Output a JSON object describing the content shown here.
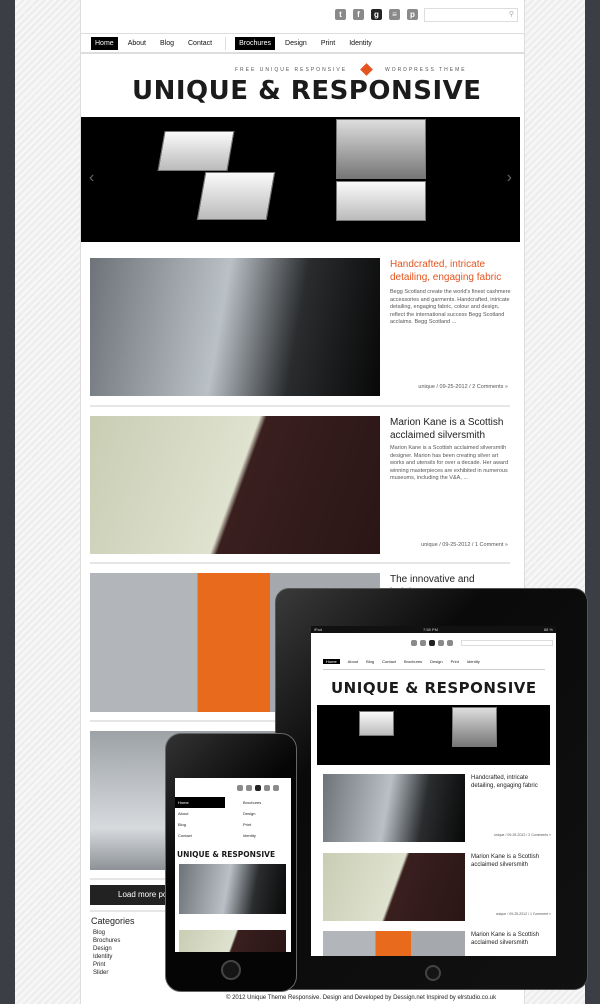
{
  "social_icons": [
    "twitter-icon",
    "facebook-icon",
    "google-plus-icon",
    "rss-icon",
    "pinterest-icon"
  ],
  "search": {
    "placeholder": "",
    "icon": "search-icon"
  },
  "nav": {
    "left": [
      "Home",
      "About",
      "Blog",
      "Contact"
    ],
    "right": [
      "Brochures",
      "Design",
      "Print",
      "Identity"
    ],
    "active": [
      "Home",
      "Brochures"
    ]
  },
  "header": {
    "tagline_left": "FREE UNIQUE RESPONSIVE",
    "tagline_right": "WORDPRESS THEME",
    "title": "UNIQUE & RESPONSIVE",
    "accent": "#e5541e"
  },
  "slider": {
    "prev": "‹",
    "next": "›"
  },
  "posts": [
    {
      "title": "Handcrafted, intricate detailing, engaging fabric",
      "excerpt": "Begg Scotland create the world's finest cashmere accessories and garments. Handcrafted, intricate detailing, engaging fabric, colour and design, reflect the international success Begg Scotland acclaims. Begg Scotland ...",
      "meta": "unique / 09-25-2012 / 2 Comments »"
    },
    {
      "title": "Marion Kane is a Scottish acclaimed silversmith",
      "excerpt": "Marion Kane is a Scottish acclaimed silversmith designer. Marion has been creating silver art works and utensils for over a decade. Her award winning masterpieces are exhibited in numerous museums, including the V&A, ...",
      "meta": "unique / 09-25-2012 / 1 Comment »"
    },
    {
      "title": "The innovative and indulgent"
    }
  ],
  "load_more": "Load more posts",
  "categories": {
    "heading": "Categories",
    "items": [
      "Blog",
      "Brochures",
      "Design",
      "Identity",
      "Print",
      "Slider"
    ]
  },
  "footer": "© 2012 Unique Theme Responsive. Design and Developed by Dessign.net Inspired by elrstudio.co.uk",
  "ipad": {
    "status_left": "iPad",
    "status_time": "7:58 PM",
    "status_right": "88 %",
    "posts": [
      {
        "title": "Handcrafted, intricate detailing, engaging fabric",
        "meta": "unique / 09-25-2012 / 2 Comments »"
      },
      {
        "title": "Marion Kane is a Scottish acclaimed silversmith",
        "meta": "unique / 09-25-2012 / 1 Comment »"
      },
      {
        "title": "Marion Kane is a Scottish acclaimed silversmith"
      }
    ]
  }
}
